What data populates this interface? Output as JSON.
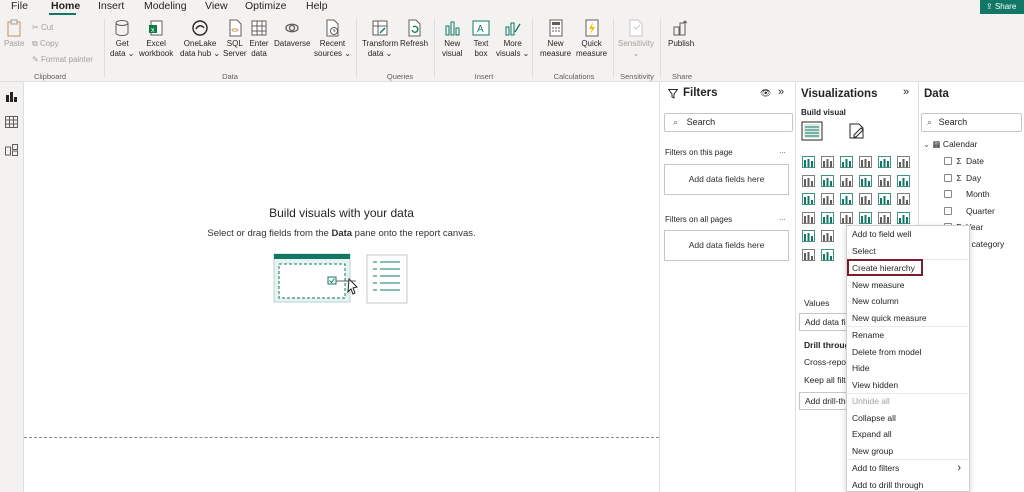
{
  "menubar": {
    "items": [
      "File",
      "Home",
      "Insert",
      "Modeling",
      "View",
      "Optimize",
      "Help"
    ],
    "active": "Home",
    "share_label": "Share"
  },
  "ribbon": {
    "clipboard": {
      "paste": "Paste",
      "cut": "Cut",
      "copy": "Copy",
      "format_painter": "Format painter",
      "group": "Clipboard"
    },
    "data": {
      "get_data": [
        "Get",
        "data ⌄"
      ],
      "excel": [
        "Excel",
        "workbook"
      ],
      "onelake": [
        "OneLake",
        "data hub ⌄"
      ],
      "sql": [
        "SQL",
        "Server"
      ],
      "enter": [
        "Enter",
        "data"
      ],
      "dataverse": [
        "Dataverse",
        ""
      ],
      "recent": [
        "Recent",
        "sources ⌄"
      ],
      "group": "Data"
    },
    "queries": {
      "transform": [
        "Transform",
        "data ⌄"
      ],
      "refresh": [
        "Refresh",
        ""
      ],
      "group": "Queries"
    },
    "insert": {
      "new_visual": [
        "New",
        "visual"
      ],
      "text_box": [
        "Text",
        "box"
      ],
      "more_visuals": [
        "More",
        "visuals ⌄"
      ],
      "group": "Insert"
    },
    "calculations": {
      "new_measure": [
        "New",
        "measure"
      ],
      "quick_measure": [
        "Quick",
        "measure"
      ],
      "group": "Calculations"
    },
    "sensitivity": {
      "label": [
        "Sensitivity",
        "⌄"
      ],
      "group": "Sensitivity"
    },
    "share": {
      "publish": "Publish",
      "group": "Share"
    }
  },
  "canvas": {
    "title": "Build visuals with your data",
    "subtitle_pre": "Select or drag fields from the ",
    "subtitle_bold": "Data",
    "subtitle_post": " pane onto the report canvas."
  },
  "filters": {
    "title": "Filters",
    "search_placeholder": "Search",
    "on_this_page": "Filters on this page",
    "on_all_pages": "Filters on all pages",
    "add_fields": "Add data fields here",
    "ellipsis": "..."
  },
  "visualizations": {
    "title": "Visualizations",
    "build_visual": "Build visual",
    "values_label": "Values",
    "add_data_partial": "Add data fi",
    "drill_through": "Drill throug",
    "cross_report": "Cross-repor",
    "keep_all": "Keep all filte",
    "add_drill": "Add drill-th"
  },
  "data_pane": {
    "title": "Data",
    "search_placeholder": "Search",
    "table": "Calendar",
    "fields": [
      {
        "label": "Date",
        "sigma": true
      },
      {
        "label": "Day",
        "sigma": true
      },
      {
        "label": "Month",
        "sigma": false
      },
      {
        "label": "Quarter",
        "sigma": false
      },
      {
        "label": "Year",
        "sigma": true
      }
    ],
    "partial_field": "ber category"
  },
  "context_menu": {
    "items": [
      {
        "label": "Add to field well",
        "disabled": false
      },
      {
        "label": "Select",
        "disabled": false
      },
      {
        "label": "Create hierarchy",
        "disabled": false,
        "highlighted": true
      },
      {
        "label": "New measure",
        "disabled": false
      },
      {
        "label": "New column",
        "disabled": false
      },
      {
        "label": "New quick measure",
        "disabled": false
      },
      {
        "label": "Rename",
        "disabled": false
      },
      {
        "label": "Delete from model",
        "disabled": false
      },
      {
        "label": "Hide",
        "disabled": false
      },
      {
        "label": "View hidden",
        "disabled": false
      },
      {
        "label": "Unhide all",
        "disabled": true
      },
      {
        "label": "Collapse all",
        "disabled": false
      },
      {
        "label": "Expand all",
        "disabled": false
      },
      {
        "label": "New group",
        "disabled": false
      },
      {
        "label": "Add to filters",
        "disabled": false,
        "submenu": true
      },
      {
        "label": "Add to drill through",
        "disabled": false
      }
    ]
  },
  "colors": {
    "accent": "#117865",
    "highlight": "#7b1e2b"
  }
}
